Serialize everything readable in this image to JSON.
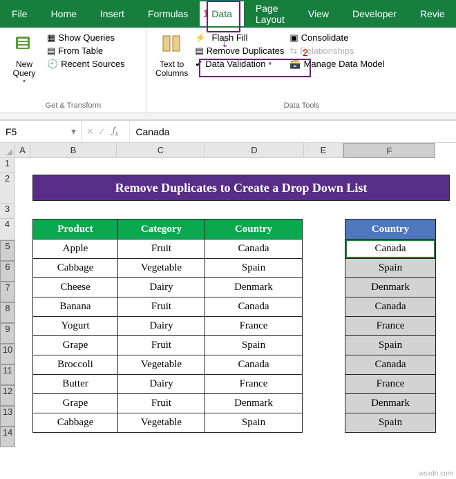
{
  "tabs": [
    "File",
    "Home",
    "Insert",
    "Formulas",
    "Data",
    "Page Layout",
    "View",
    "Developer",
    "Revie"
  ],
  "activeTab": "Data",
  "ribbon": {
    "group1": {
      "label": "Get & Transform",
      "newQuery": "New\nQuery",
      "showQueries": "Show Queries",
      "fromTable": "From Table",
      "recentSources": "Recent Sources"
    },
    "group2": {
      "label": "Data Tools",
      "textToColumns": "Text to\nColumns",
      "flashFill": "Flash Fill",
      "removeDuplicates": "Remove Duplicates",
      "dataValidation": "Data Validation",
      "consolidate": "Consolidate",
      "relationships": "Relationships",
      "manageDataModel": "Manage Data Model"
    }
  },
  "annotations": {
    "step1": "1",
    "step2": "2"
  },
  "nameBox": "F5",
  "formulaValue": "Canada",
  "columns": [
    "A",
    "B",
    "C",
    "D",
    "E",
    "F"
  ],
  "rows": [
    "1",
    "2",
    "3",
    "4",
    "5",
    "6",
    "7",
    "8",
    "9",
    "10",
    "11",
    "12",
    "13",
    "14"
  ],
  "banner": "Remove Duplicates to Create a Drop Down List",
  "table1": {
    "headers": [
      "Product",
      "Category",
      "Country"
    ],
    "rows": [
      [
        "Apple",
        "Fruit",
        "Canada"
      ],
      [
        "Cabbage",
        "Vegetable",
        "Spain"
      ],
      [
        "Cheese",
        "Dairy",
        "Denmark"
      ],
      [
        "Banana",
        "Fruit",
        "Canada"
      ],
      [
        "Yogurt",
        "Dairy",
        "France"
      ],
      [
        "Grape",
        "Fruit",
        "Spain"
      ],
      [
        "Broccoli",
        "Vegetable",
        "Canada"
      ],
      [
        "Butter",
        "Dairy",
        "France"
      ],
      [
        "Grape",
        "Fruit",
        "Denmark"
      ],
      [
        "Cabbage",
        "Vegetable",
        "Spain"
      ]
    ]
  },
  "table2": {
    "header": "Country",
    "rows": [
      "Canada",
      "Spain",
      "Denmark",
      "Canada",
      "France",
      "Spain",
      "Canada",
      "France",
      "Denmark",
      "Spain"
    ]
  },
  "watermark": "wsxdn.com"
}
